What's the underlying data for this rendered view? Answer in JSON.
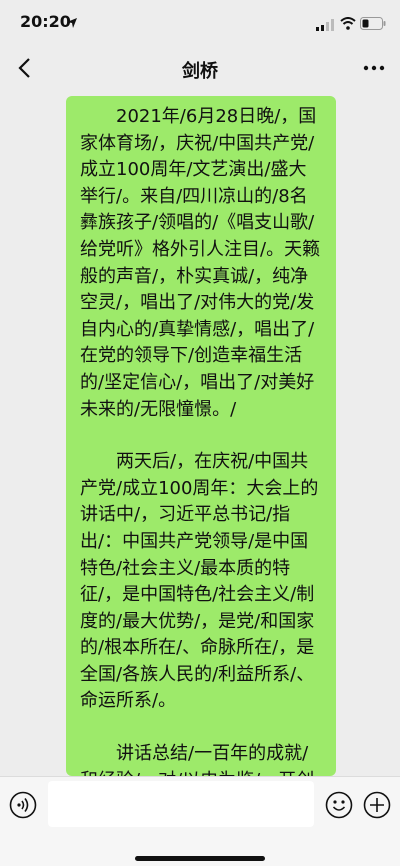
{
  "status_bar": {
    "time": "20:20"
  },
  "nav": {
    "title": "剑桥"
  },
  "message": {
    "paragraphs": [
      "2021年/6月28日晚/，国家体育场/，庆祝/中国共产党/成立100周年/文艺演出/盛大举行/。来自/四川凉山的/8名彝族孩子/领唱的/《唱支山歌/给党听》格外引人注目/。天籁般的声音/，朴实真诚/，纯净空灵/，唱出了/对伟大的党/发自内心的/真挚情感/，唱出了/在党的领导下/创造幸福生活的/坚定信心/，唱出了/对美好未来的/无限憧憬。/",
      "两天后/，在庆祝/中国共产党/成立100周年：大会上的讲话中/，习近平总书记/指出/：中国共产党领导/是中国特色/社会主义/最本质的特征/，是中国特色/社会主义/制度的/最大优势/，是党/和国家的/根本所在/、命脉所在/，是全国/各族人民的/利益所系/、命运所系/。",
      "讲话总结/一百年的成就/和经验/，对/以史为鉴/、开创未来/提出了/九个方面的要求/，其中第一位的/就是"
    ]
  },
  "input": {
    "value": ""
  },
  "icons": {
    "back": "chevron-left-icon",
    "more": "more-dots-icon",
    "voice": "voice-icon",
    "emoji": "emoji-icon",
    "plus": "plus-icon"
  },
  "colors": {
    "bubble": "#9dea6a",
    "background": "#ededed"
  }
}
